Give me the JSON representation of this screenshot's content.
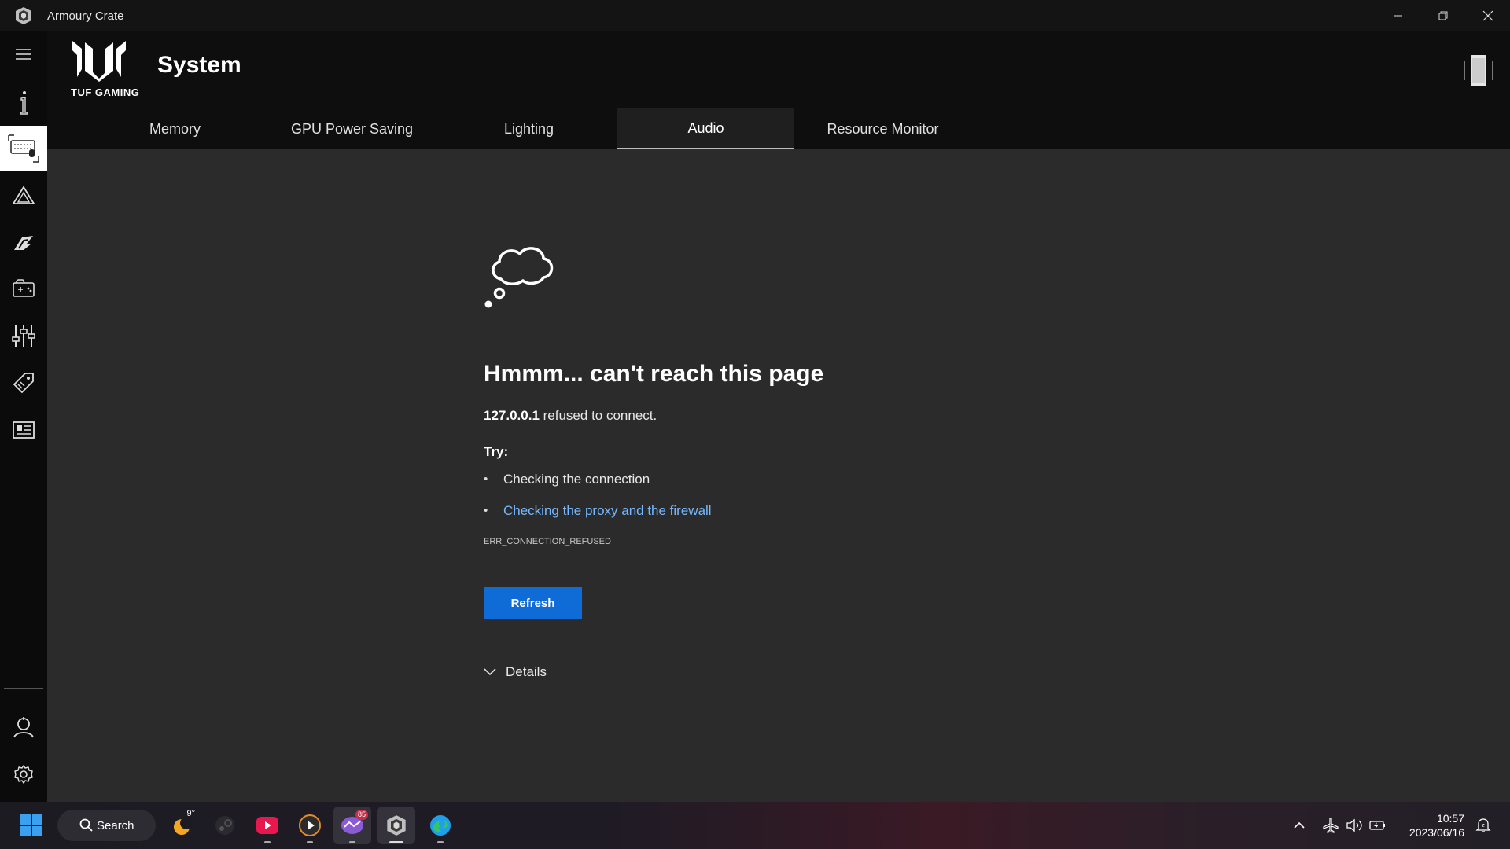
{
  "window": {
    "title": "Armoury Crate"
  },
  "header": {
    "logo_text": "TUF GAMING",
    "page_title": "System"
  },
  "tabs": [
    {
      "label": "Memory",
      "active": false
    },
    {
      "label": "GPU Power Saving",
      "active": false
    },
    {
      "label": "Lighting",
      "active": false
    },
    {
      "label": "Audio",
      "active": true
    },
    {
      "label": "Resource Monitor",
      "active": false
    }
  ],
  "sidebar": {
    "items": [
      {
        "icon": "menu-icon"
      },
      {
        "icon": "info-icon"
      },
      {
        "icon": "keyboard-device-icon",
        "active": true
      },
      {
        "icon": "aura-sync-icon"
      },
      {
        "icon": "game-deals-icon"
      },
      {
        "icon": "game-library-icon"
      },
      {
        "icon": "scenario-profiles-icon"
      },
      {
        "icon": "deals-tag-icon"
      },
      {
        "icon": "news-icon"
      },
      {
        "icon": "user-center-icon"
      },
      {
        "icon": "settings-icon"
      }
    ]
  },
  "error_page": {
    "title": "Hmmm... can't reach this page",
    "host": "127.0.0.1",
    "message": "refused to connect.",
    "try_label": "Try:",
    "suggestions": [
      {
        "text": "Checking the connection",
        "link": false
      },
      {
        "text": "Checking the proxy and the firewall",
        "link": true
      }
    ],
    "error_code": "ERR_CONNECTION_REFUSED",
    "refresh_label": "Refresh",
    "details_label": "Details"
  },
  "taskbar": {
    "search_label": "Search",
    "weather_temp": "9°",
    "notification_badge": "85",
    "time": "10:57",
    "date": "2023/06/16"
  },
  "colors": {
    "accent_button": "#0f6cd6",
    "link": "#76b8ff",
    "content_bg": "#2b2b2b"
  }
}
